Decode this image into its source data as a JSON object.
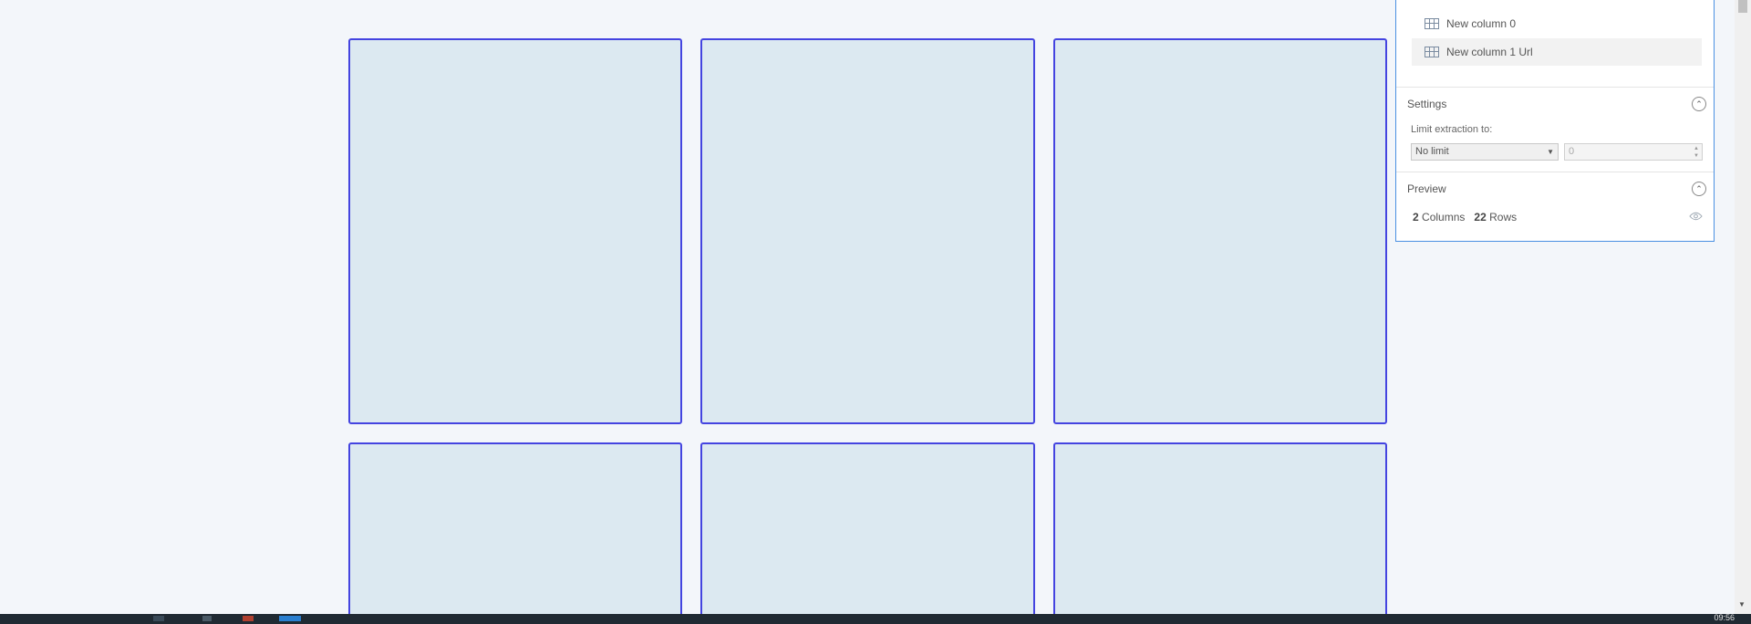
{
  "panel": {
    "columns": [
      {
        "label": "New column 0"
      },
      {
        "label": "New column 1 Url"
      }
    ],
    "settings": {
      "title": "Settings",
      "limit_label": "Limit extraction to:",
      "limit_select": "No limit",
      "limit_value": "0"
    },
    "preview": {
      "title": "Preview",
      "columns_count": "2",
      "columns_word": "Columns",
      "rows_count": "22",
      "rows_word": "Rows"
    }
  },
  "taskbar": {
    "clock": "09:56"
  },
  "icons": {
    "table": "table-icon",
    "collapse": "chevron-up-icon",
    "eye": "eye-icon"
  },
  "colors": {
    "card_border": "#4444e0",
    "card_fill": "#dce9f1",
    "panel_border": "#4a90e2"
  }
}
